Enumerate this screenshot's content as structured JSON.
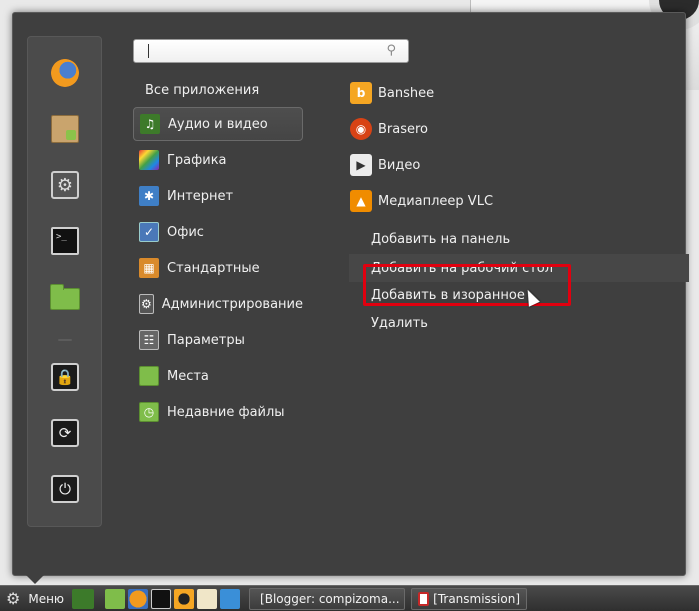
{
  "search": {
    "value": "",
    "placeholder": ""
  },
  "categories": {
    "all_label": "Все приложения",
    "items": [
      {
        "label": "Аудио и видео",
        "icon": "audio-video-icon",
        "selected": true
      },
      {
        "label": "Графика",
        "icon": "graphics-icon"
      },
      {
        "label": "Интернет",
        "icon": "internet-icon"
      },
      {
        "label": "Офис",
        "icon": "office-icon"
      },
      {
        "label": "Стандартные",
        "icon": "accessories-icon"
      },
      {
        "label": "Администрирование",
        "icon": "administration-icon"
      },
      {
        "label": "Параметры",
        "icon": "preferences-icon"
      },
      {
        "label": "Места",
        "icon": "places-folder-icon"
      },
      {
        "label": "Недавние файлы",
        "icon": "recent-files-icon"
      }
    ]
  },
  "applications": [
    {
      "label": "Banshee",
      "icon": "banshee-icon"
    },
    {
      "label": "Brasero",
      "icon": "brasero-icon"
    },
    {
      "label": "Видео",
      "icon": "video-icon"
    },
    {
      "label": "Медиаплеер VLC",
      "icon": "vlc-icon"
    }
  ],
  "context_menu": [
    "Добавить на панель",
    "Добавить на рабочий стол",
    "Добавить в изоранное",
    "Удалить"
  ],
  "favorites": [
    "firefox-icon",
    "software-manager-icon",
    "system-settings-icon",
    "terminal-icon",
    "home-folder-icon",
    "lock-screen-icon",
    "logout-icon",
    "shutdown-icon"
  ],
  "panel": {
    "menu_label": "Меню",
    "tasks": [
      {
        "label": "[Blogger: compizoma...",
        "icon": "firefox-icon"
      },
      {
        "label": "[Transmission]",
        "icon": "transmission-icon"
      }
    ]
  },
  "colors": {
    "menu_bg": "#3f3f3f",
    "highlight_border": "#e1000f",
    "panel_bg": "#3a3a3a"
  }
}
